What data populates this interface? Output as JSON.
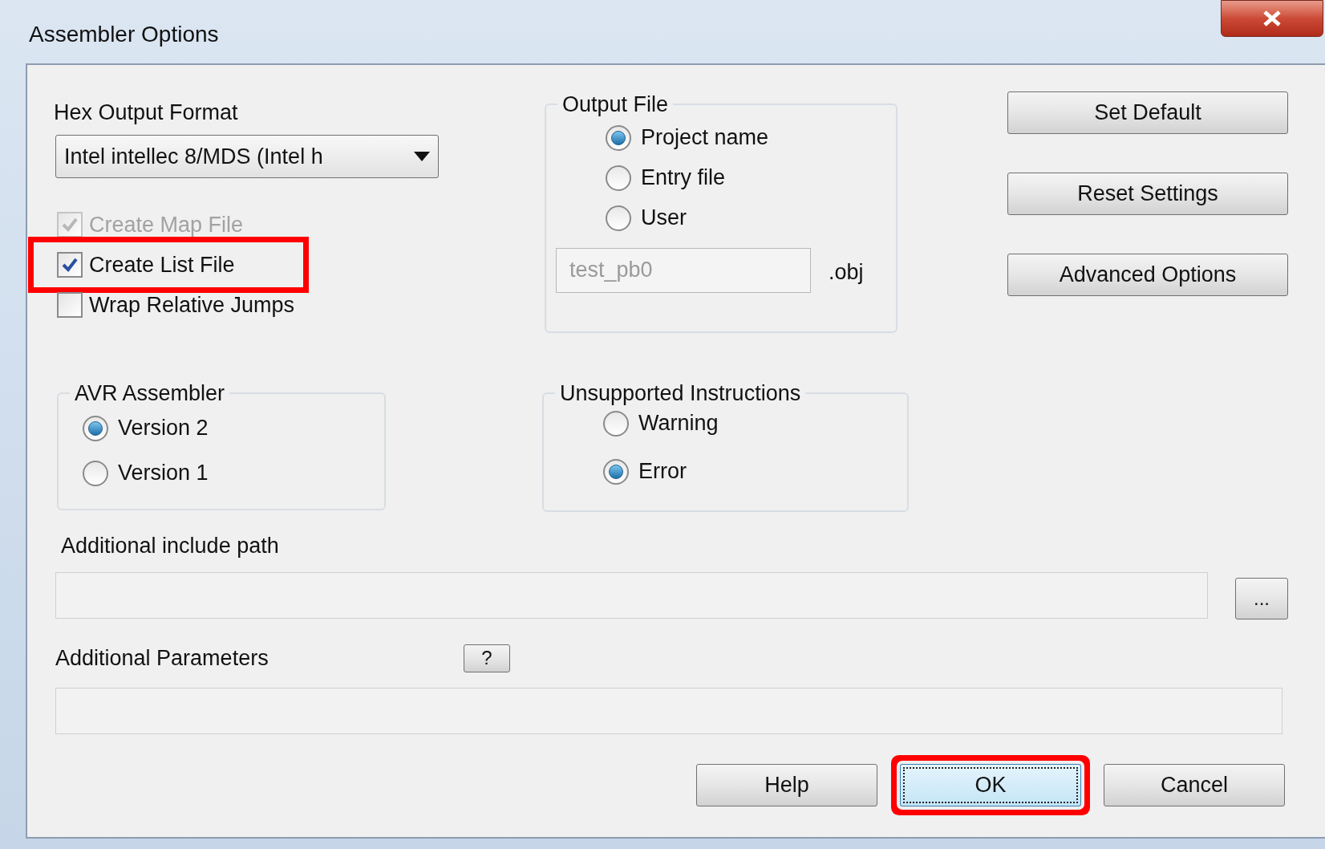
{
  "window": {
    "title": "Assembler Options"
  },
  "hex_output_format": {
    "label": "Hex Output Format",
    "value": "Intel intellec 8/MDS (Intel h"
  },
  "checkboxes": [
    {
      "label": "Create Map File",
      "checked": true,
      "disabled": true,
      "highlighted": false
    },
    {
      "label": "Create List File",
      "checked": true,
      "disabled": false,
      "highlighted": true
    },
    {
      "label": "Wrap Relative Jumps",
      "checked": false,
      "disabled": false,
      "highlighted": false
    }
  ],
  "output_file": {
    "title": "Output File",
    "options": [
      {
        "label": "Project name",
        "selected": true
      },
      {
        "label": "Entry file",
        "selected": false
      },
      {
        "label": "User",
        "selected": false
      }
    ],
    "filename": {
      "value": "test_pb0",
      "disabled": true
    },
    "extension": ".obj"
  },
  "side_buttons": [
    "Set Default",
    "Reset Settings",
    "Advanced Options"
  ],
  "avr_assembler": {
    "title": "AVR Assembler",
    "options": [
      {
        "label": "Version 2",
        "selected": true
      },
      {
        "label": "Version 1",
        "selected": false
      }
    ]
  },
  "unsupported_instructions": {
    "title": "Unsupported Instructions",
    "options": [
      {
        "label": "Warning",
        "selected": false
      },
      {
        "label": "Error",
        "selected": true
      }
    ]
  },
  "include_path": {
    "label": "Additional include path",
    "browse": "..."
  },
  "parameters": {
    "label": "Additional Parameters",
    "help": "?"
  },
  "buttons": [
    {
      "label": "Help",
      "focused": false,
      "highlighted": false
    },
    {
      "label": "OK",
      "focused": true,
      "highlighted": true
    },
    {
      "label": "Cancel",
      "focused": false,
      "highlighted": false
    }
  ]
}
